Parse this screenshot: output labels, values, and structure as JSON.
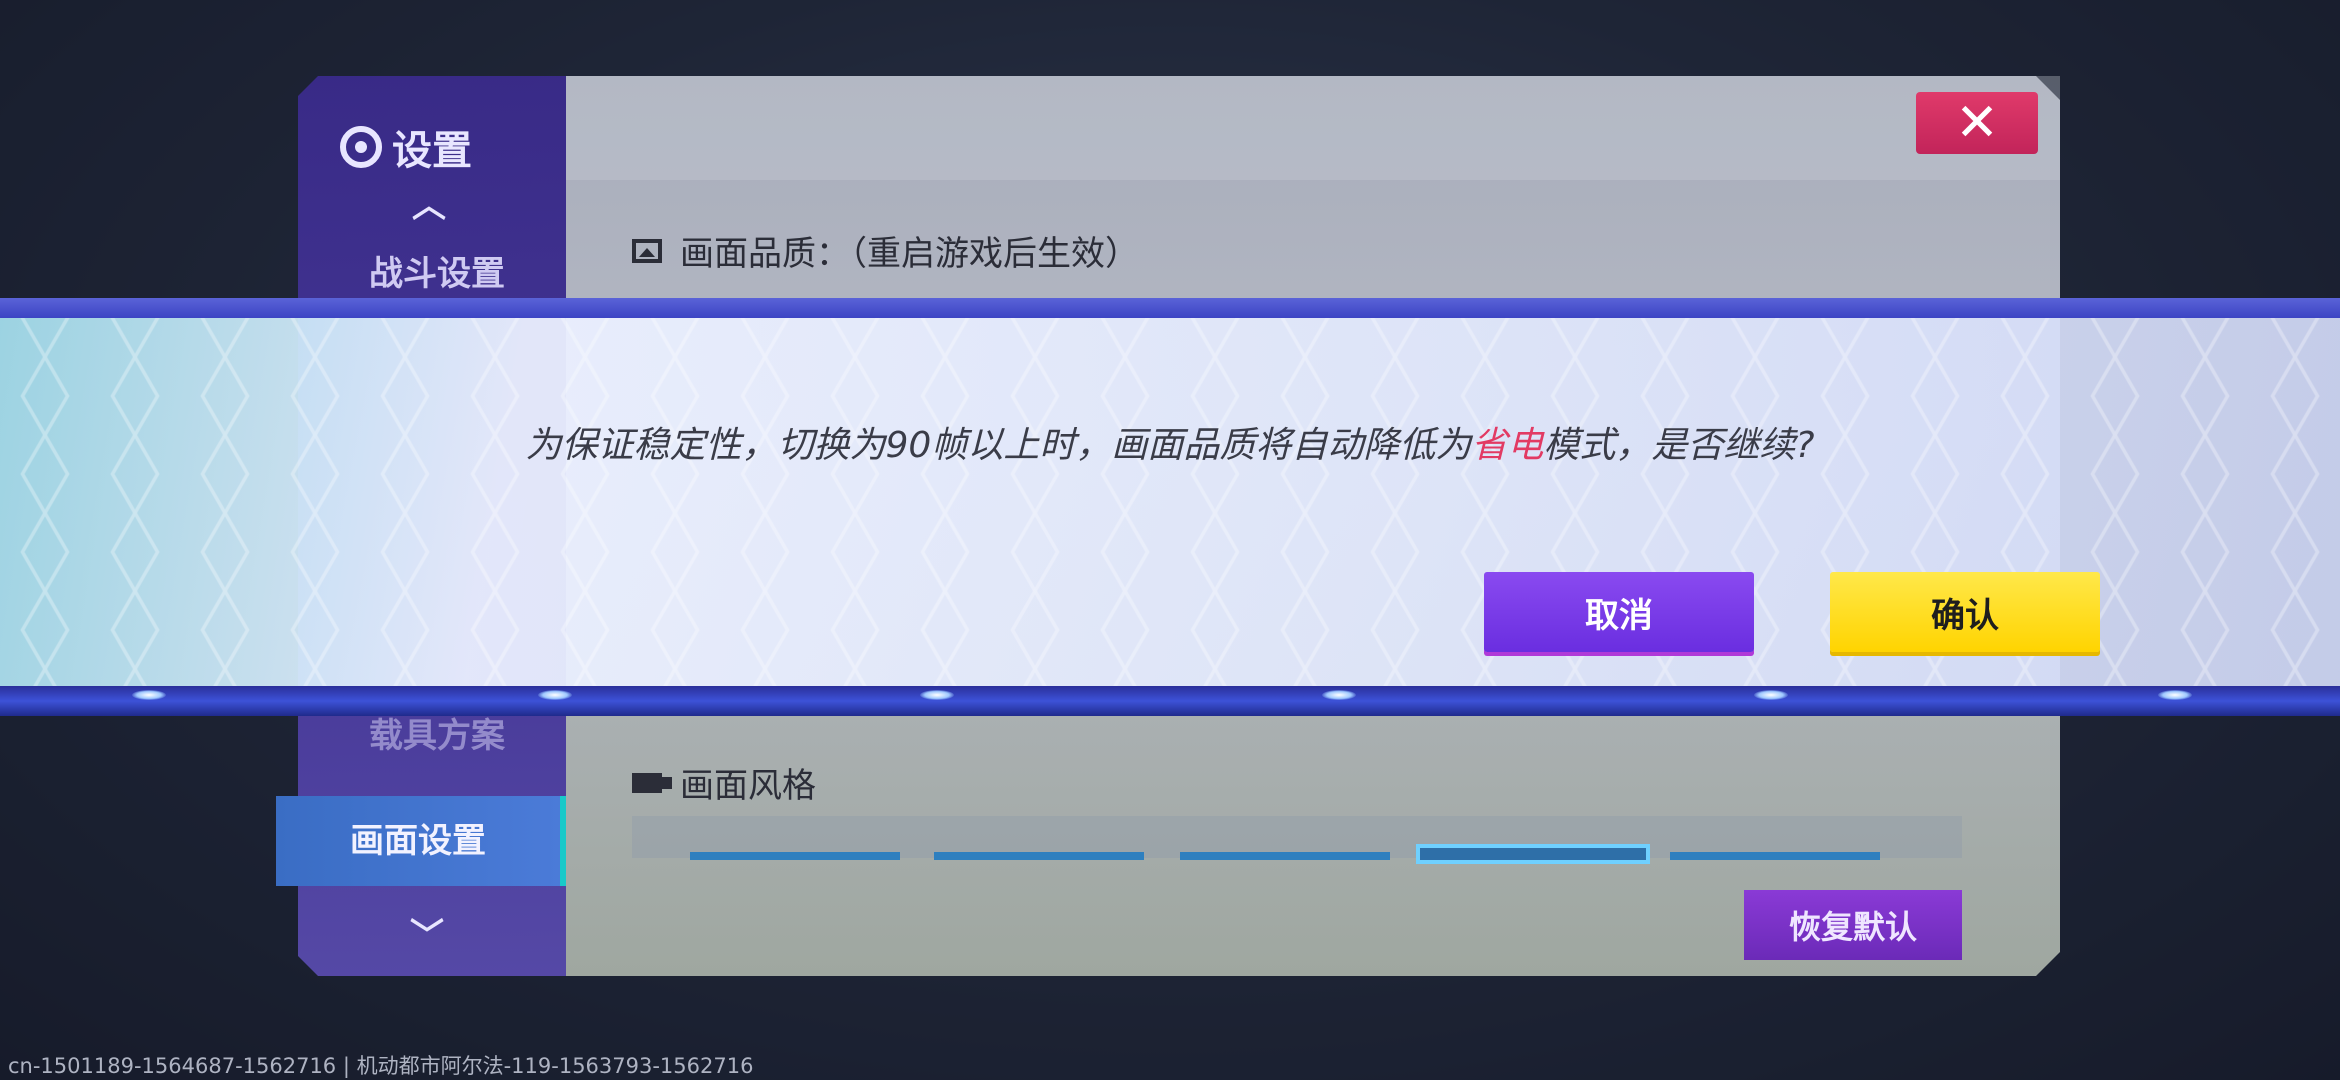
{
  "settings": {
    "title": "设置",
    "nav": [
      "战斗设置",
      "载具方案",
      "画面设置"
    ],
    "active_nav": "画面设置",
    "quality_heading": "画面品质：（重启游戏后生效）",
    "style_heading": "画面风格",
    "restore_label": "恢复默认"
  },
  "dialog": {
    "text_before": "为保证稳定性，切换为90帧以上时，画面品质将自动降低为",
    "text_highlight": "省电",
    "text_after": "模式，是否继续?",
    "cancel_label": "取消",
    "confirm_label": "确认"
  },
  "footer": {
    "id_text": "cn-1501189-1564687-1562716 | 机动都市阿尔法-119-1563793-1562716"
  },
  "colors": {
    "highlight": "#e23a63",
    "confirm": "#ffd400",
    "cancel": "#7a3ce8"
  }
}
